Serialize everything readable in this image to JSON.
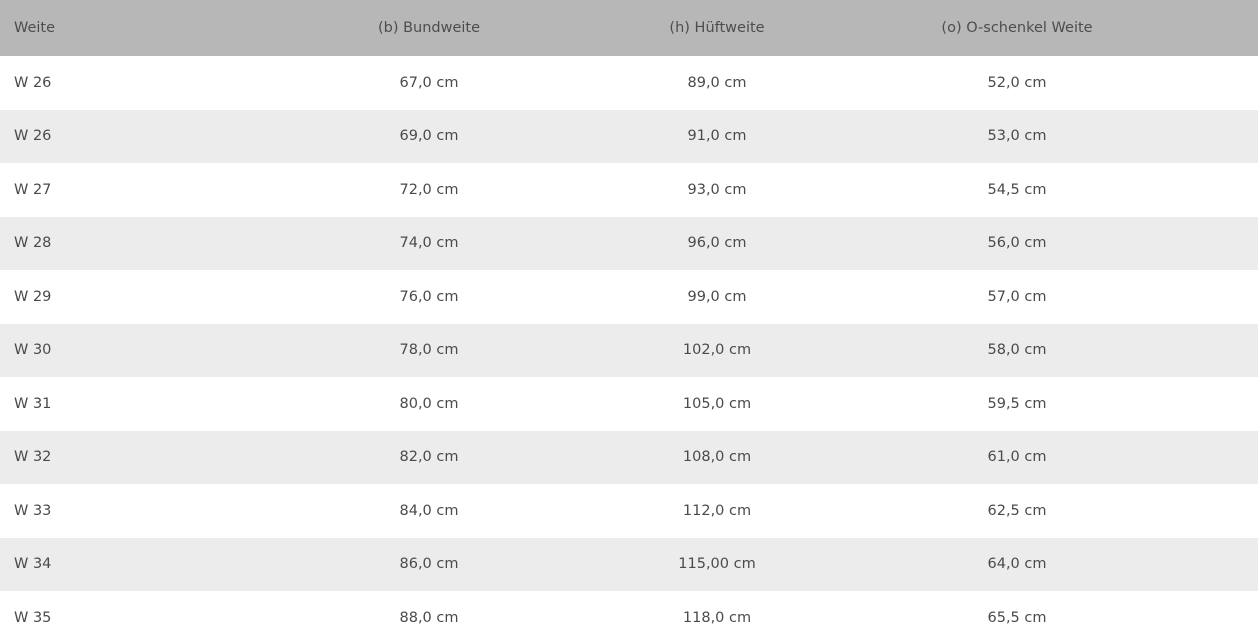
{
  "table": {
    "headers": [
      "Weite",
      "(b) Bundweite",
      "(h) Hüftweite",
      "(o) O-schenkel Weite"
    ],
    "rows": [
      [
        "W 26",
        "67,0 cm",
        "89,0 cm",
        "52,0 cm"
      ],
      [
        "W 26",
        "69,0 cm",
        "91,0 cm",
        "53,0 cm"
      ],
      [
        "W 27",
        "72,0 cm",
        "93,0 cm",
        "54,5 cm"
      ],
      [
        "W 28",
        "74,0 cm",
        "96,0 cm",
        "56,0 cm"
      ],
      [
        "W 29",
        "76,0 cm",
        "99,0 cm",
        "57,0 cm"
      ],
      [
        "W 30",
        "78,0 cm",
        "102,0 cm",
        "58,0 cm"
      ],
      [
        "W 31",
        "80,0 cm",
        "105,0 cm",
        "59,5 cm"
      ],
      [
        "W 32",
        "82,0 cm",
        "108,0 cm",
        "61,0 cm"
      ],
      [
        "W 33",
        "84,0 cm",
        "112,0 cm",
        "62,5 cm"
      ],
      [
        "W 34",
        "86,0 cm",
        "115,00 cm",
        "64,0 cm"
      ],
      [
        "W 35",
        "88,0 cm",
        "118,0 cm",
        "65,5 cm"
      ]
    ]
  },
  "colors": {
    "header_bg": "#b7b7b7",
    "row_alt_bg": "#ebeceb",
    "row_bg": "#ffffff",
    "text": "#4a4a4a"
  }
}
